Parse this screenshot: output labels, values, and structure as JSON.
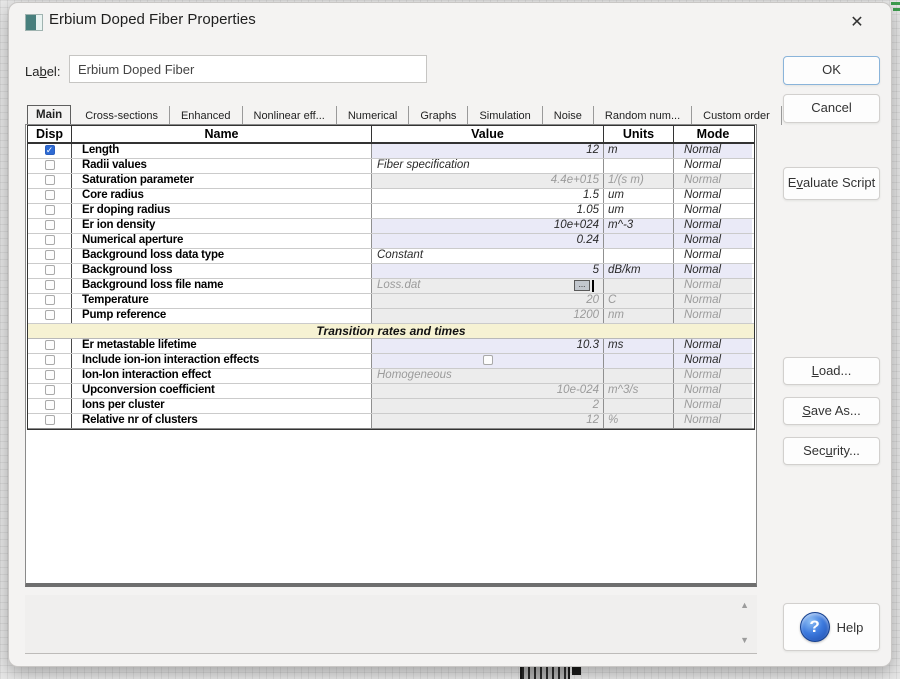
{
  "window": {
    "title": "Erbium Doped Fiber Properties"
  },
  "label_field": {
    "pre": "La",
    "mn": "b",
    "post": "el:",
    "value": "Erbium Doped Fiber"
  },
  "tabs": [
    {
      "label": "Main",
      "active": true
    },
    {
      "label": "Cross-sections"
    },
    {
      "label": "Enhanced"
    },
    {
      "label": "Nonlinear eff..."
    },
    {
      "label": "Numerical"
    },
    {
      "label": "Graphs"
    },
    {
      "label": "Simulation"
    },
    {
      "label": "Noise"
    },
    {
      "label": "Random num..."
    },
    {
      "label": "Custom order"
    }
  ],
  "table": {
    "headers": [
      "Disp",
      "Name",
      "Value",
      "Units",
      "Mode"
    ],
    "rows": [
      {
        "name": "Length",
        "value": "12",
        "units": "m",
        "mode": "Normal",
        "checked": true,
        "bg": "lav",
        "kind": "number"
      },
      {
        "name": "Radii values",
        "value": "Fiber specification",
        "units": "",
        "mode": "Normal",
        "bg": "white",
        "kind": "text"
      },
      {
        "name": "Saturation parameter",
        "value": "4.4e+015",
        "units": "1/(s m)",
        "mode": "Normal",
        "bg": "white",
        "kind": "number",
        "disabled": true
      },
      {
        "name": "Core radius",
        "value": "1.5",
        "units": "um",
        "mode": "Normal",
        "bg": "white",
        "kind": "number"
      },
      {
        "name": "Er doping radius",
        "value": "1.05",
        "units": "um",
        "mode": "Normal",
        "bg": "white",
        "kind": "number"
      },
      {
        "name": "Er ion density",
        "value": "10e+024",
        "units": "m^-3",
        "mode": "Normal",
        "bg": "lav",
        "kind": "number"
      },
      {
        "name": "Numerical aperture",
        "value": "0.24",
        "units": "",
        "mode": "Normal",
        "bg": "lav",
        "kind": "number"
      },
      {
        "name": "Background loss data type",
        "value": "Constant",
        "units": "",
        "mode": "Normal",
        "bg": "white",
        "kind": "text"
      },
      {
        "name": "Background loss",
        "value": "5",
        "units": "dB/km",
        "mode": "Normal",
        "bg": "lav",
        "kind": "number"
      },
      {
        "name": "Background loss file name",
        "value": "Loss.dat",
        "units": "",
        "mode": "Normal",
        "bg": "white",
        "kind": "file",
        "disabled": true,
        "browse_label": "..."
      },
      {
        "name": "Temperature",
        "value": "20",
        "units": "C",
        "mode": "Normal",
        "bg": "white",
        "kind": "number",
        "disabled": true
      },
      {
        "name": "Pump reference",
        "value": "1200",
        "units": "nm",
        "mode": "Normal",
        "bg": "white",
        "kind": "number",
        "disabled": true
      },
      {
        "type": "section",
        "title": "Transition rates and times"
      },
      {
        "name": "Er metastable lifetime",
        "value": "10.3",
        "units": "ms",
        "mode": "Normal",
        "bg": "lav",
        "kind": "number"
      },
      {
        "name": "Include ion-ion interaction effects",
        "value": "",
        "units": "",
        "mode": "Normal",
        "bg": "lav",
        "kind": "checkbox"
      },
      {
        "name": "Ion-Ion interaction effect",
        "value": "Homogeneous",
        "units": "",
        "mode": "Normal",
        "bg": "white",
        "kind": "text",
        "disabled": true
      },
      {
        "name": "Upconversion coefficient",
        "value": "10e-024",
        "units": "m^3/s",
        "mode": "Normal",
        "bg": "white",
        "kind": "number",
        "disabled": true
      },
      {
        "name": "Ions per cluster",
        "value": "2",
        "units": "",
        "mode": "Normal",
        "bg": "white",
        "kind": "number",
        "disabled": true
      },
      {
        "name": "Relative nr of clusters",
        "value": "12",
        "units": "%",
        "mode": "Normal",
        "bg": "white",
        "kind": "number",
        "disabled": true
      }
    ]
  },
  "buttons": {
    "ok": {
      "label": "OK"
    },
    "cancel": {
      "label": "Cancel"
    },
    "evaluate": {
      "pre": "E",
      "mn": "v",
      "post": "aluate Script"
    },
    "load": {
      "pre": "",
      "mn": "L",
      "post": "oad..."
    },
    "save_as": {
      "pre": "",
      "mn": "S",
      "post": "ave As..."
    },
    "security": {
      "pre": "Sec",
      "mn": "u",
      "post": "rity..."
    },
    "help": {
      "label": "Help",
      "icon_glyph": "?"
    }
  },
  "icons": {
    "close": "✕",
    "check": "✓",
    "up_arrow": "▲",
    "down_arrow": "▼"
  }
}
